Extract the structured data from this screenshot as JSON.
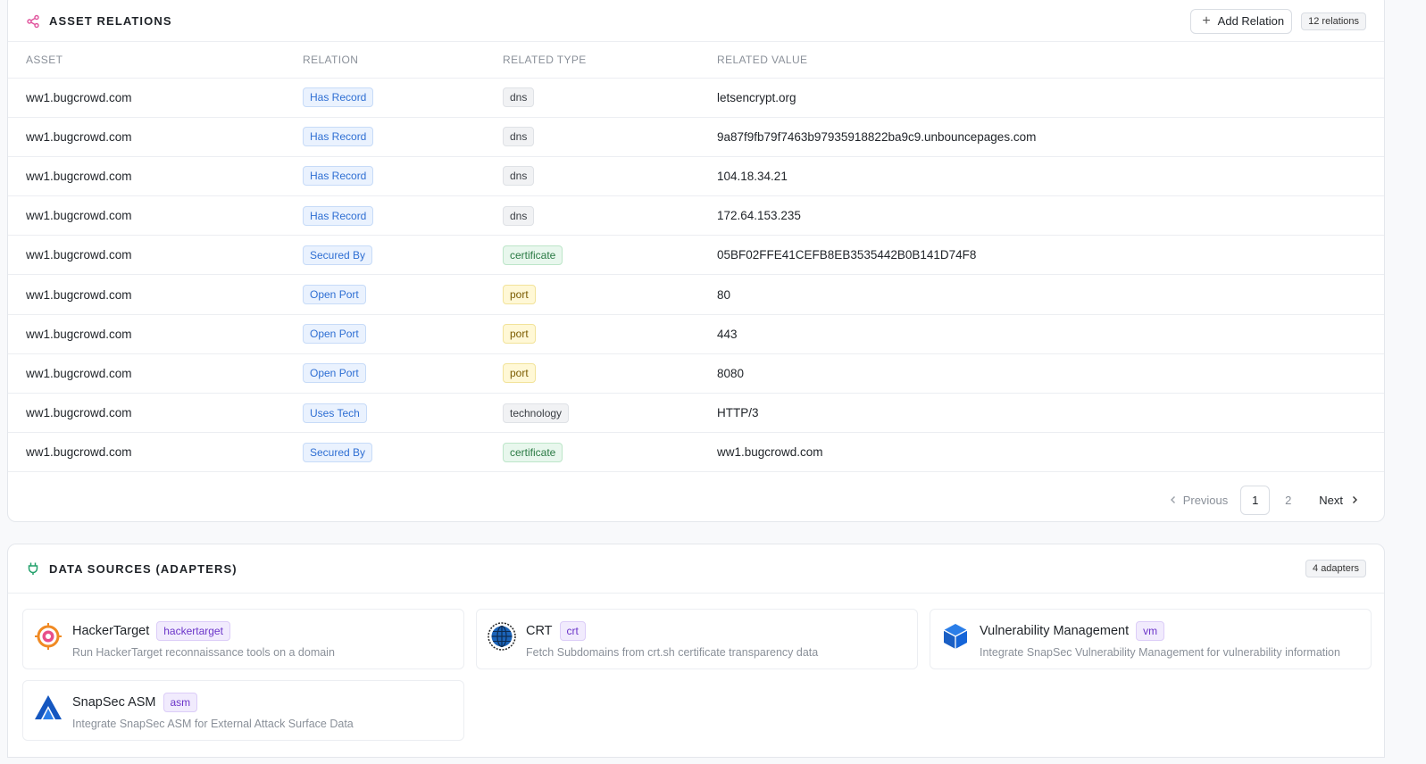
{
  "relations": {
    "title": "ASSET RELATIONS",
    "add_label": "Add Relation",
    "count_label": "12 relations",
    "columns": {
      "asset": "ASSET",
      "relation": "RELATION",
      "related_type": "RELATED TYPE",
      "related_value": "RELATED VALUE"
    },
    "rows": [
      {
        "asset": "ww1.bugcrowd.com",
        "relation": "Has Record",
        "type": "dns",
        "value": "letsencrypt.org"
      },
      {
        "asset": "ww1.bugcrowd.com",
        "relation": "Has Record",
        "type": "dns",
        "value": "9a87f9fb79f7463b97935918822ba9c9.unbouncepages.com"
      },
      {
        "asset": "ww1.bugcrowd.com",
        "relation": "Has Record",
        "type": "dns",
        "value": "104.18.34.21"
      },
      {
        "asset": "ww1.bugcrowd.com",
        "relation": "Has Record",
        "type": "dns",
        "value": "172.64.153.235"
      },
      {
        "asset": "ww1.bugcrowd.com",
        "relation": "Secured By",
        "type": "certificate",
        "value": "05BF02FFE41CEFB8EB3535442B0B141D74F8"
      },
      {
        "asset": "ww1.bugcrowd.com",
        "relation": "Open Port",
        "type": "port",
        "value": "80"
      },
      {
        "asset": "ww1.bugcrowd.com",
        "relation": "Open Port",
        "type": "port",
        "value": "443"
      },
      {
        "asset": "ww1.bugcrowd.com",
        "relation": "Open Port",
        "type": "port",
        "value": "8080"
      },
      {
        "asset": "ww1.bugcrowd.com",
        "relation": "Uses Tech",
        "type": "technology",
        "value": "HTTP/3"
      },
      {
        "asset": "ww1.bugcrowd.com",
        "relation": "Secured By",
        "type": "certificate",
        "value": "ww1.bugcrowd.com"
      }
    ],
    "pagination": {
      "previous": "Previous",
      "next": "Next",
      "pages": [
        "1",
        "2"
      ],
      "current": "1"
    }
  },
  "sources": {
    "title": "DATA SOURCES (ADAPTERS)",
    "count_label": "4 adapters",
    "adapters": [
      {
        "name": "HackerTarget",
        "tag": "hackertarget",
        "desc": "Run HackerTarget reconnaissance tools on a domain",
        "icon": "hackertarget-logo-icon"
      },
      {
        "name": "CRT",
        "tag": "crt",
        "desc": "Fetch Subdomains from crt.sh certificate transparency data",
        "icon": "globe-icon"
      },
      {
        "name": "Vulnerability Management",
        "tag": "vm",
        "desc": "Integrate SnapSec Vulnerability Management for vulnerability information",
        "icon": "cube-icon"
      },
      {
        "name": "SnapSec ASM",
        "tag": "asm",
        "desc": "Integrate SnapSec ASM for External Attack Surface Data",
        "icon": "snapsec-logo-icon"
      }
    ]
  },
  "colors": {
    "relation_badge": "#2f6fd3",
    "tag_purple": "#6b35c9",
    "share_icon": "#e0529c",
    "plug_icon": "#22a06b"
  }
}
